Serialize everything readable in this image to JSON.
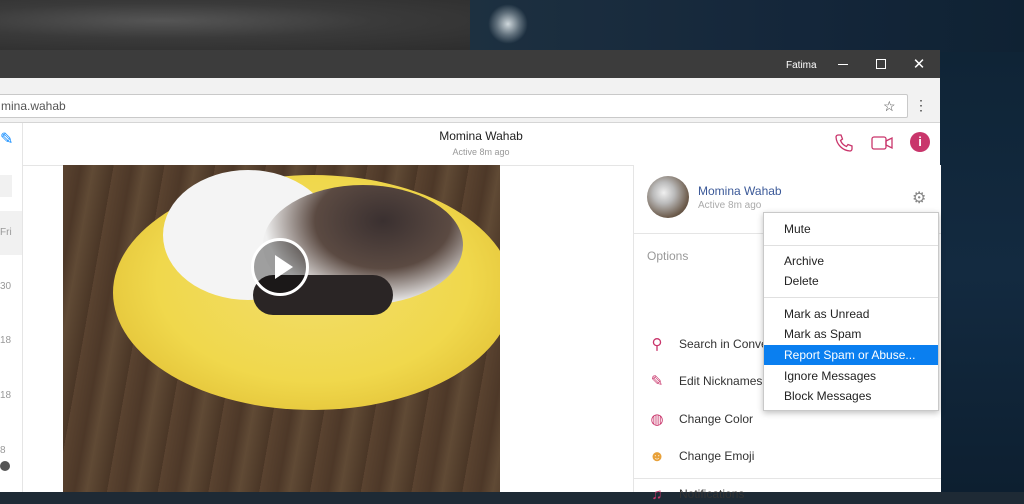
{
  "window": {
    "user": "Fatima"
  },
  "address": {
    "url": "mina.wahab"
  },
  "left_rail": {
    "times": [
      "Fri",
      "30",
      "18",
      "18",
      "8"
    ]
  },
  "conversation": {
    "name": "Momina Wahab",
    "status": "Active 8m ago"
  },
  "profile": {
    "name": "Momina Wahab",
    "status": "Active 8m ago"
  },
  "options": {
    "title": "Options",
    "items": [
      {
        "label": "Search in Conve",
        "icon": "search-icon"
      },
      {
        "label": "Edit Nicknames",
        "icon": "pencil-icon"
      },
      {
        "label": "Change Color",
        "icon": "palette-icon"
      },
      {
        "label": "Change Emoji",
        "icon": "emoji-icon"
      },
      {
        "label": "Notifications",
        "icon": "bell-icon"
      }
    ]
  },
  "menu": {
    "items": [
      {
        "label": "Mute"
      },
      {
        "label": "Archive"
      },
      {
        "label": "Delete"
      },
      {
        "label": "Mark as Unread"
      },
      {
        "label": "Mark as Spam"
      },
      {
        "label": "Report Spam or Abuse...",
        "highlighted": true
      },
      {
        "label": "Ignore Messages"
      },
      {
        "label": "Block Messages"
      }
    ]
  },
  "colors": {
    "accent": "#c9356b",
    "highlight": "#0a7ff0",
    "link": "#3b5998"
  }
}
